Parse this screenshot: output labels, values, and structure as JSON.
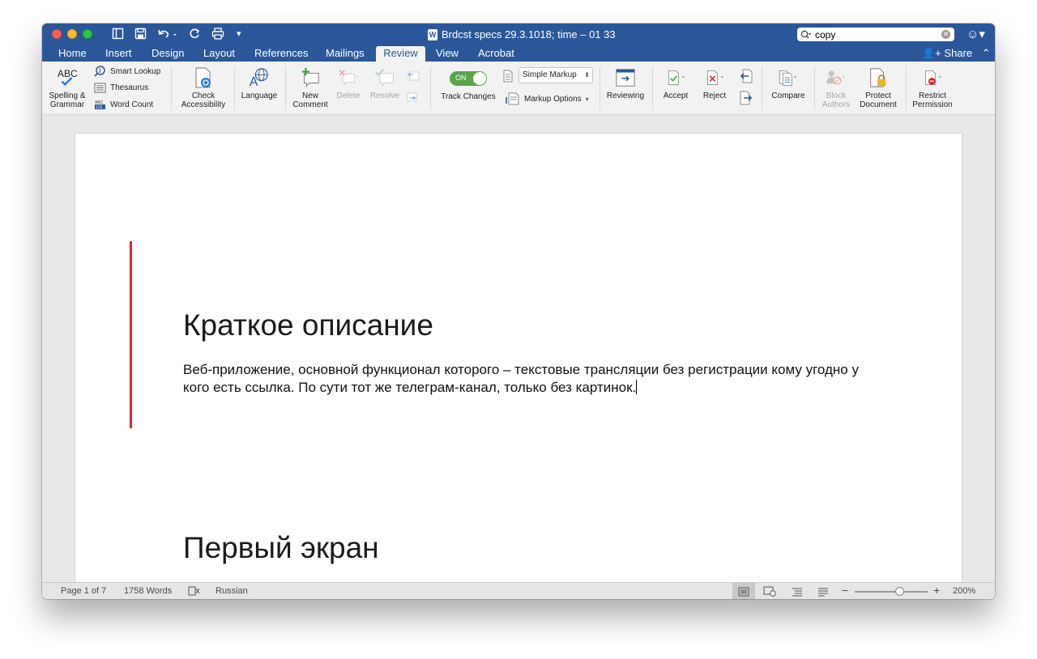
{
  "titlebar": {
    "doc_title": "Brdcst specs 29.3.1018; time – 01 33",
    "search_value": "copy",
    "qa_icons": [
      "sidebar-toggle-icon",
      "save-icon",
      "undo-icon",
      "redo-icon",
      "print-icon",
      "customize-icon"
    ]
  },
  "tabs": [
    "Home",
    "Insert",
    "Design",
    "Layout",
    "References",
    "Mailings",
    "Review",
    "View",
    "Acrobat"
  ],
  "active_tab": "Review",
  "share_label": "Share",
  "ribbon": {
    "spelling": "Spelling &\nGrammar",
    "smart_lookup": "Smart Lookup",
    "thesaurus": "Thesaurus",
    "word_count": "Word Count",
    "check_accessibility": "Check\nAccessibility",
    "language": "Language",
    "new_comment": "New\nComment",
    "delete": "Delete",
    "resolve": "Resolve",
    "track_changes": "Track Changes",
    "track_toggle": "ON",
    "markup_select": "Simple Markup",
    "markup_options": "Markup Options",
    "reviewing": "Reviewing",
    "accept": "Accept",
    "reject": "Reject",
    "compare": "Compare",
    "block_authors": "Block\nAuthors",
    "protect_document": "Protect\nDocument",
    "restrict_permission": "Restrict\nPermission"
  },
  "document": {
    "heading1": "Краткое описание",
    "paragraph": "Веб-приложение, основной функционал которого – текстовые трансляции без регистрации кому угодно у кого есть ссылка. По сути тот же телеграм-канал, только без картинок.",
    "heading2": "Первый экран"
  },
  "status": {
    "page": "Page 1 of 7",
    "words": "1758 Words",
    "language": "Russian",
    "zoom": "200%"
  },
  "colors": {
    "brand": "#2b579a",
    "accent_red": "#e0262e",
    "toggle_on": "#57a64a"
  }
}
